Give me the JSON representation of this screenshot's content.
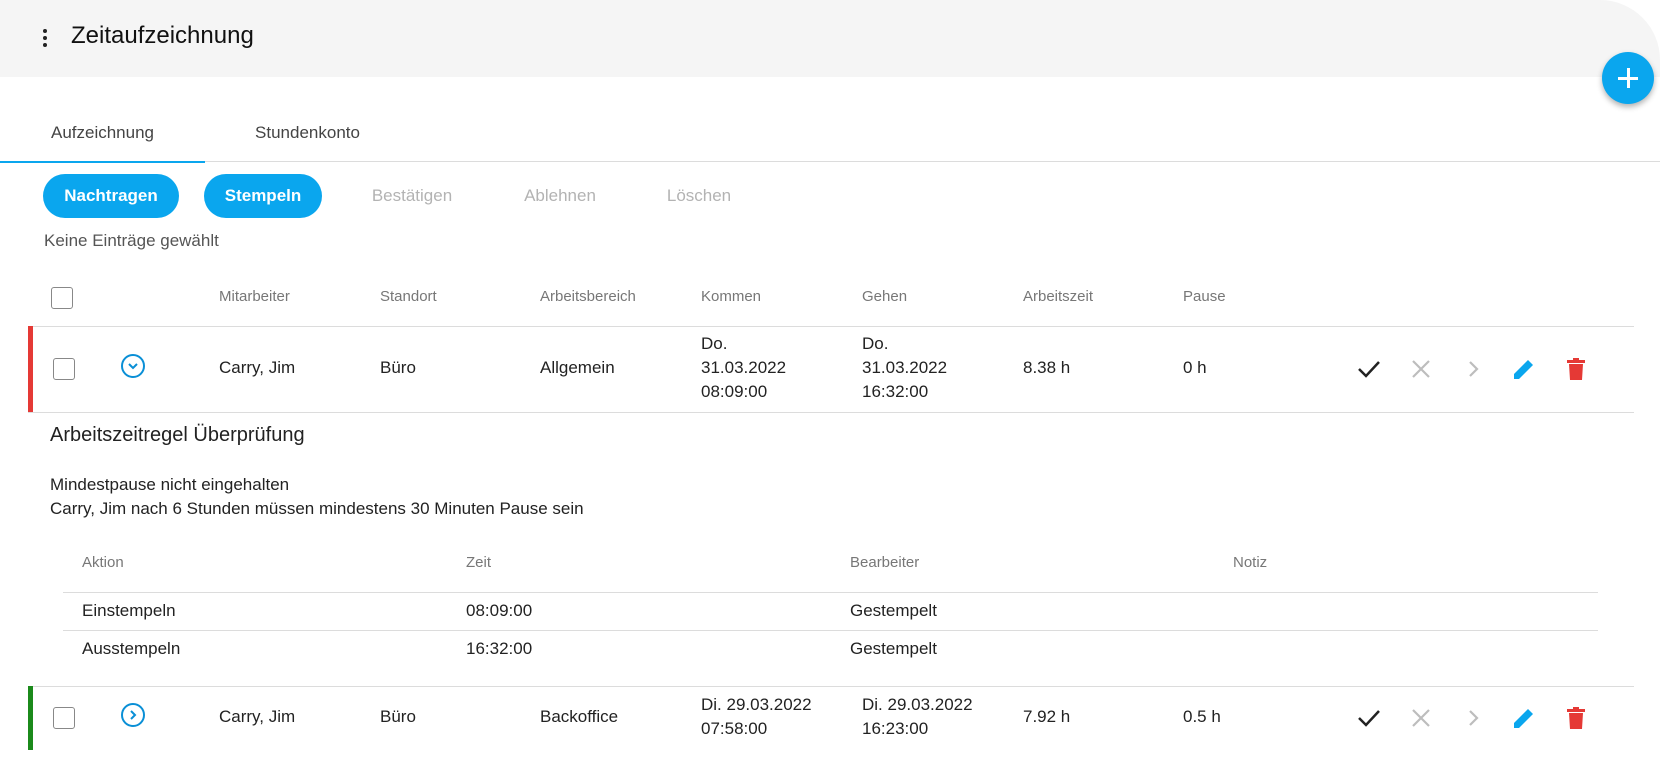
{
  "header": {
    "title": "Zeitaufzeichnung"
  },
  "tabs": [
    {
      "label": "Aufzeichnung"
    },
    {
      "label": "Stundenkonto"
    }
  ],
  "toolbar": {
    "nachtragen": "Nachtragen",
    "stempeln": "Stempeln",
    "bestaetigen": "Bestätigen",
    "ablehnen": "Ablehnen",
    "loeschen": "Löschen"
  },
  "selection_info": "Keine Einträge gewählt",
  "table": {
    "columns": [
      "Mitarbeiter",
      "Standort",
      "Arbeitsbereich",
      "Kommen",
      "Gehen",
      "Arbeitszeit",
      "Pause"
    ],
    "rows": [
      {
        "status_color": "#e53935",
        "mitarbeiter": "Carry, Jim",
        "standort": "Büro",
        "arbeitsbereich": "Allgemein",
        "kommen_day": "Do.",
        "kommen_date": "31.03.2022",
        "kommen_time": "08:09:00",
        "gehen_day": "Do.",
        "gehen_date": "31.03.2022",
        "gehen_time": "16:32:00",
        "arbeitszeit": "8.38 h",
        "pause": "0 h",
        "expanded": true
      },
      {
        "status_color": "#1b8a1b",
        "mitarbeiter": "Carry, Jim",
        "standort": "Büro",
        "arbeitsbereich": "Backoffice",
        "kommen_date": "Di. 29.03.2022",
        "kommen_time": "07:58:00",
        "gehen_date": "Di. 29.03.2022",
        "gehen_time": "16:23:00",
        "arbeitszeit": "7.92 h",
        "pause": "0.5 h",
        "expanded": false
      }
    ]
  },
  "rule_check": {
    "title": "Arbeitszeitregel Überprüfung",
    "message": "Mindestpause nicht eingehalten",
    "detail": "Carry, Jim nach 6 Stunden müssen mindestens 30 Minuten Pause sein"
  },
  "subtable": {
    "columns": [
      "Aktion",
      "Zeit",
      "Bearbeiter",
      "Notiz"
    ],
    "rows": [
      {
        "aktion": "Einstempeln",
        "zeit": "08:09:00",
        "bearbeiter": "Gestempelt",
        "notiz": ""
      },
      {
        "aktion": "Ausstempeln",
        "zeit": "16:32:00",
        "bearbeiter": "Gestempelt",
        "notiz": ""
      }
    ]
  },
  "icons": {
    "menu": "more-vert-icon",
    "add": "plus-icon",
    "confirm": "check-icon",
    "reject": "close-icon",
    "forward": "chevron-right-icon",
    "edit": "pencil-icon",
    "delete": "trash-icon"
  },
  "colors": {
    "accent": "#0aa6ee",
    "delete": "#e53935"
  }
}
